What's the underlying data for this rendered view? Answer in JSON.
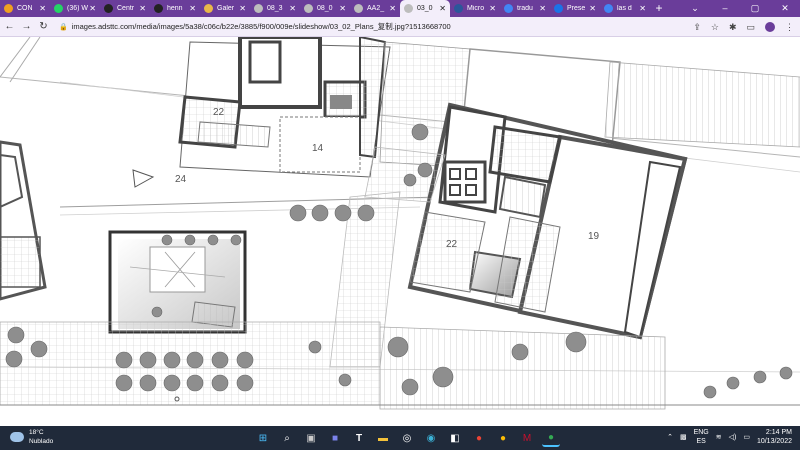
{
  "browser": {
    "tabs": [
      {
        "label": "CON",
        "color": "#f0a020"
      },
      {
        "label": "(36) W",
        "color": "#25d366"
      },
      {
        "label": "Centr",
        "color": "#222222"
      },
      {
        "label": "henn",
        "color": "#222222"
      },
      {
        "label": "Galer",
        "color": "#e9b84a"
      },
      {
        "label": "08_3",
        "color": "#bdbdbd"
      },
      {
        "label": "08_0",
        "color": "#bdbdbd"
      },
      {
        "label": "AA2_",
        "color": "#bdbdbd"
      },
      {
        "label": "03_0",
        "color": "#bdbdbd"
      },
      {
        "label": "Micro",
        "color": "#2b579a"
      },
      {
        "label": "tradu",
        "color": "#4285f4"
      },
      {
        "label": "Prese",
        "color": "#1a73e8"
      },
      {
        "label": "las d",
        "color": "#4285f4"
      }
    ],
    "active_tab_index": 8,
    "url": "images.adsttc.com/media/images/5a38/c06c/b22e/3885/f900/009e/slideshow/03_02_Plans_复制.jpg?1513668700"
  },
  "plan_labels": {
    "room_22_top": "22",
    "room_14": "14",
    "room_24": "24",
    "room_22_right": "22",
    "room_19": "19"
  },
  "taskbar": {
    "temperature": "18°C",
    "weather": "Nublado",
    "lang1": "ENG",
    "lang2": "ES",
    "time": "2:14 PM",
    "date": "10/13/2022"
  }
}
